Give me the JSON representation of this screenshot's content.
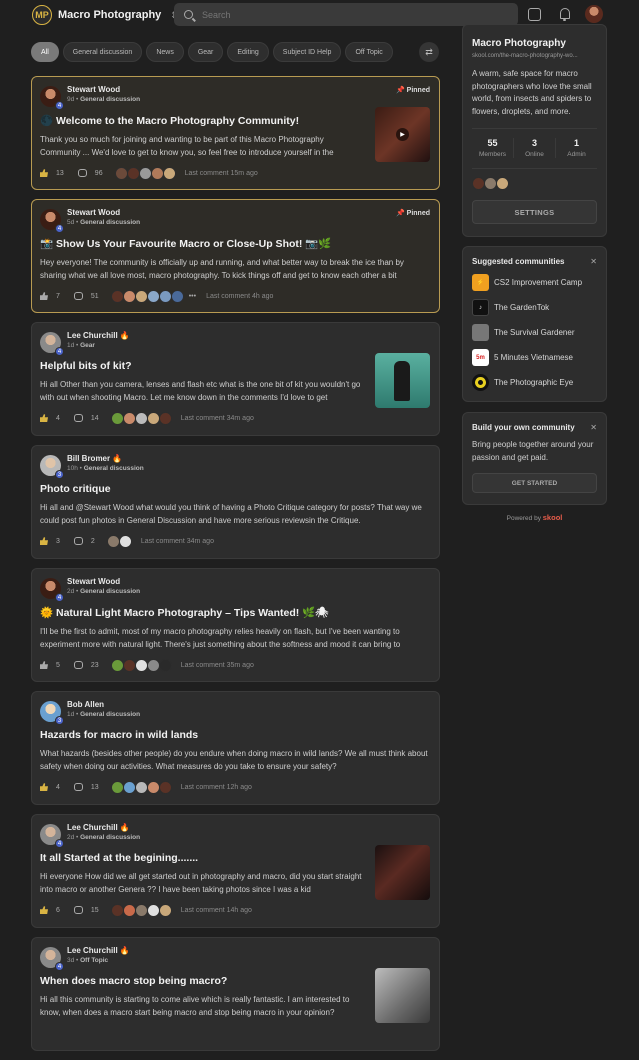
{
  "header": {
    "logo_text": "MP",
    "community_name": "Macro Photography",
    "search_placeholder": "Search"
  },
  "filters": [
    "All",
    "General discussion",
    "News",
    "Gear",
    "Editing",
    "Subject ID Help",
    "Off Topic"
  ],
  "posts": [
    {
      "author": "Stewart Wood",
      "level": "4",
      "time": "9d",
      "category": "General discussion",
      "pinned": "Pinned",
      "title": "Welcome to the Macro Photography Community!",
      "body": "Thank you so much for joining and wanting to be part of this Macro Photography Community ... We'd love to get to know you, so feel free to introduce yourself in the",
      "likes": "13",
      "comments": "96",
      "last": "Last comment 15m ago",
      "title_icon": "🌑"
    },
    {
      "author": "Stewart Wood",
      "level": "4",
      "time": "5d",
      "category": "General discussion",
      "pinned": "Pinned",
      "title": "Show Us Your Favourite Macro or Close-Up Shot! 📷🌿",
      "body": "Hey everyone! The community is officially up and running, and what better way to break the ice than by sharing what we all love most, macro photography. To kick things off and get to know each other a bit",
      "likes": "7",
      "comments": "51",
      "last": "Last comment 4h ago",
      "title_icon": "📸"
    },
    {
      "author": "Lee Churchill 🔥",
      "level": "4",
      "time": "1d",
      "category": "Gear",
      "title": "Helpful bits of kit?",
      "body": "Hi all Other than you camera, lenses and flash etc what is the one bit of kit you wouldn't go with out when shooting Macro. Let me know down in the comments I'd love to get",
      "likes": "4",
      "comments": "14",
      "last": "Last comment 34m ago"
    },
    {
      "author": "Bill Bromer 🔥",
      "level": "3",
      "time": "10h",
      "category": "General discussion",
      "title": "Photo critique",
      "body": "Hi all and @Stewart Wood what would you think of having a Photo Critique category for posts? That way we could post fun photos in General Discussion and have more serious reviewsin the Critique.",
      "likes": "3",
      "comments": "2",
      "last": "Last comment 34m ago"
    },
    {
      "author": "Stewart Wood",
      "level": "4",
      "time": "2d",
      "category": "General discussion",
      "title": "Natural Light Macro Photography – Tips Wanted! 🌿🕷",
      "body": "I'll be the first to admit, most of my macro photography relies heavily on flash, but I've been wanting to experiment more with natural light. There's just something about the softness and mood it can bring to",
      "likes": "5",
      "comments": "23",
      "last": "Last comment 35m ago",
      "title_icon": "🌞"
    },
    {
      "author": "Bob Allen",
      "level": "3",
      "time": "1d",
      "category": "General discussion",
      "title": "Hazards for macro in wild lands",
      "body": "What hazards (besides other people) do you endure when doing macro in wild lands? We all must think about safety when doing our activities. What measures do you take to ensure your safety?",
      "likes": "4",
      "comments": "13",
      "last": "Last comment 12h ago"
    },
    {
      "author": "Lee Churchill 🔥",
      "level": "4",
      "time": "2d",
      "category": "General discussion",
      "title": "It all Started at the begining.......",
      "body": "Hi everyone How did we all get started out in photography and macro, did you start straight into macro or another Genera ?? I have been taking photos since I was a kid",
      "likes": "6",
      "comments": "15",
      "last": "Last comment 14h ago"
    },
    {
      "author": "Lee Churchill 🔥",
      "level": "4",
      "time": "3d",
      "category": "Off Topic",
      "title": "When does macro stop being macro?",
      "body": "Hi all this community is starting to come alive which is really fantastic. I am interested to know, when does a macro start being macro and stop being macro in your opinion?",
      "likes": "",
      "comments": "",
      "last": ""
    }
  ],
  "about": {
    "name": "Macro Photography",
    "url": "skool.com/the-macro-photography-wo...",
    "description": "A warm, safe space for macro photographers who love the small world, from insects and spiders to flowers, droplets, and more.",
    "stats": [
      {
        "n": "55",
        "l": "Members"
      },
      {
        "n": "3",
        "l": "Online"
      },
      {
        "n": "1",
        "l": "Admin"
      }
    ],
    "settings_label": "SETTINGS"
  },
  "suggested": {
    "heading": "Suggested communities",
    "items": [
      {
        "name": "CS2 Improvement Camp",
        "icon": "cs2-icon"
      },
      {
        "name": "The GardenTok",
        "icon": "gardentok-icon"
      },
      {
        "name": "The Survival Gardener",
        "icon": "survival-gardener-icon"
      },
      {
        "name": "5 Minutes Vietnamese",
        "icon": "5m-icon",
        "icon_text": "5m"
      },
      {
        "name": "The Photographic Eye",
        "icon": "photographic-eye-icon"
      }
    ]
  },
  "build": {
    "heading": "Build your own community",
    "description": "Bring people together around your passion and get paid.",
    "button": "GET STARTED"
  },
  "powered": {
    "prefix": "Powered by",
    "brand": "skool"
  },
  "colors": {
    "pinned_border": "#b89b52",
    "like_active": "#d9b443",
    "level_badge": "#4a63c9",
    "background": "#1f1f1f",
    "card": "#2d2d2d"
  }
}
